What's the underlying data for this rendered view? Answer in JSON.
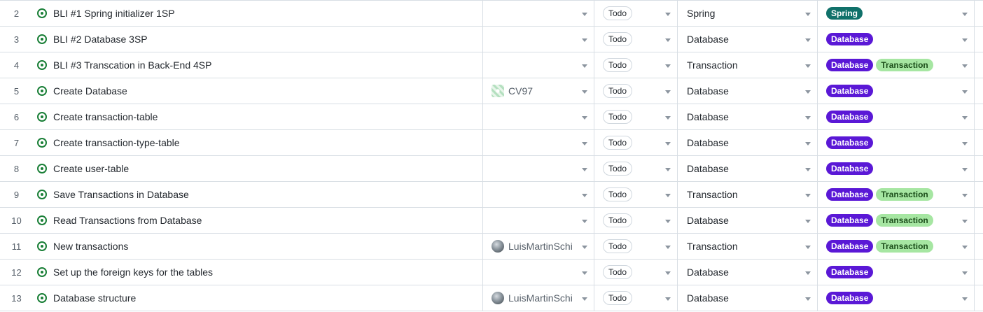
{
  "rows": [
    {
      "num": "2",
      "title": "BLI #1 Spring initializer 1SP",
      "assignee": "",
      "status": "Todo",
      "category": "Spring",
      "labels": [
        "Spring"
      ]
    },
    {
      "num": "3",
      "title": "BLI #2 Database 3SP",
      "assignee": "",
      "status": "Todo",
      "category": "Database",
      "labels": [
        "Database"
      ]
    },
    {
      "num": "4",
      "title": "BLI #3 Transcation in Back-End 4SP",
      "assignee": "",
      "status": "Todo",
      "category": "Transaction",
      "labels": [
        "Database",
        "Transaction"
      ]
    },
    {
      "num": "5",
      "title": "Create Database",
      "assignee": "CV97",
      "status": "Todo",
      "category": "Database",
      "labels": [
        "Database"
      ]
    },
    {
      "num": "6",
      "title": "Create transaction-table",
      "assignee": "",
      "status": "Todo",
      "category": "Database",
      "labels": [
        "Database"
      ]
    },
    {
      "num": "7",
      "title": "Create transaction-type-table",
      "assignee": "",
      "status": "Todo",
      "category": "Database",
      "labels": [
        "Database"
      ]
    },
    {
      "num": "8",
      "title": "Create user-table",
      "assignee": "",
      "status": "Todo",
      "category": "Database",
      "labels": [
        "Database"
      ]
    },
    {
      "num": "9",
      "title": "Save Transactions in Database",
      "assignee": "",
      "status": "Todo",
      "category": "Transaction",
      "labels": [
        "Database",
        "Transaction"
      ]
    },
    {
      "num": "10",
      "title": "Read Transactions from Database",
      "assignee": "",
      "status": "Todo",
      "category": "Database",
      "labels": [
        "Database",
        "Transaction"
      ]
    },
    {
      "num": "11",
      "title": "New transactions",
      "assignee": "LuisMartinSchic",
      "status": "Todo",
      "category": "Transaction",
      "labels": [
        "Database",
        "Transaction"
      ]
    },
    {
      "num": "12",
      "title": "Set up the foreign keys for the tables",
      "assignee": "",
      "status": "Todo",
      "category": "Database",
      "labels": [
        "Database"
      ]
    },
    {
      "num": "13",
      "title": "Database structure",
      "assignee": "LuisMartinSchic",
      "status": "Todo",
      "category": "Database",
      "labels": [
        "Database"
      ]
    }
  ],
  "label_colors": {
    "Spring": "#10716a",
    "Database": "#5a18d6",
    "Transaction": "#a6e6a2"
  },
  "icons": {
    "issue": "open-issue-icon",
    "dropdown": "chevron-down-icon",
    "avatar_cv97": "identicon-avatar",
    "avatar_luis": "photo-avatar"
  }
}
